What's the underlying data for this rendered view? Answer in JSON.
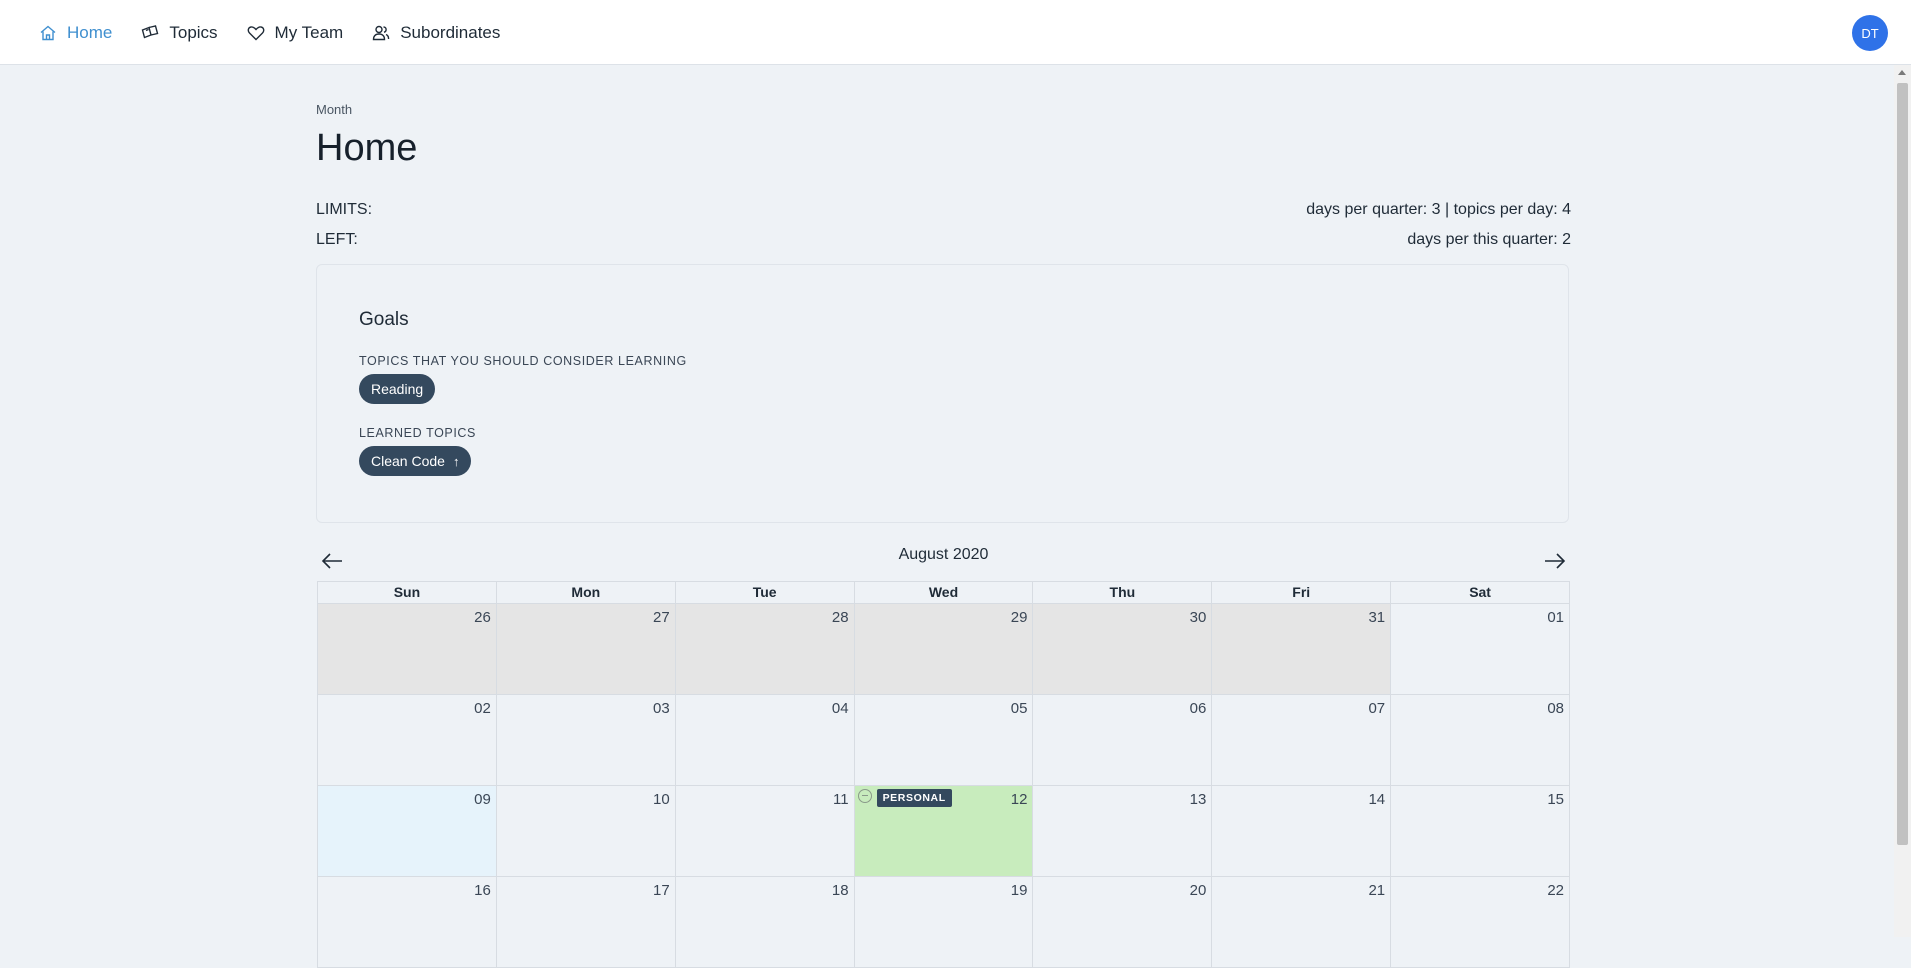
{
  "nav": {
    "items": [
      {
        "label": "Home",
        "icon": "home-icon",
        "active": true
      },
      {
        "label": "Topics",
        "icon": "topics-icon",
        "active": false
      },
      {
        "label": "My Team",
        "icon": "heart-icon",
        "active": false
      },
      {
        "label": "Subordinates",
        "icon": "users-icon",
        "active": false
      }
    ],
    "avatar_initials": "DT"
  },
  "page": {
    "breadcrumb": "Month",
    "title": "Home"
  },
  "limits": {
    "limits_label": "LIMITS:",
    "limits_value": "days per quarter: 3 | topics per day: 4",
    "left_label": "LEFT:",
    "left_value": "days per this quarter: 2"
  },
  "goals": {
    "title": "Goals",
    "consider_label": "TOPICS THAT YOU SHOULD CONSIDER LEARNING",
    "consider_topics": [
      "Reading"
    ],
    "learned_label": "LEARNED TOPICS",
    "learned_topics": [
      "Clean Code"
    ]
  },
  "calendar": {
    "month_label": "August 2020",
    "weekdays": [
      "Sun",
      "Mon",
      "Tue",
      "Wed",
      "Thu",
      "Fri",
      "Sat"
    ],
    "weeks": [
      [
        "26",
        "27",
        "28",
        "29",
        "30",
        "31",
        "01"
      ],
      [
        "02",
        "03",
        "04",
        "05",
        "06",
        "07",
        "08"
      ],
      [
        "09",
        "10",
        "11",
        "12",
        "13",
        "14",
        "15"
      ],
      [
        "16",
        "17",
        "18",
        "19",
        "20",
        "21",
        "22"
      ]
    ],
    "event": {
      "day": "12",
      "label": "PERSONAL"
    },
    "colors": {
      "off_month": "#e5e5e5",
      "today": "#e6f3fb",
      "event_day": "#c8ecbd",
      "accent": "#3f8fcf",
      "pill": "#34495e"
    }
  }
}
